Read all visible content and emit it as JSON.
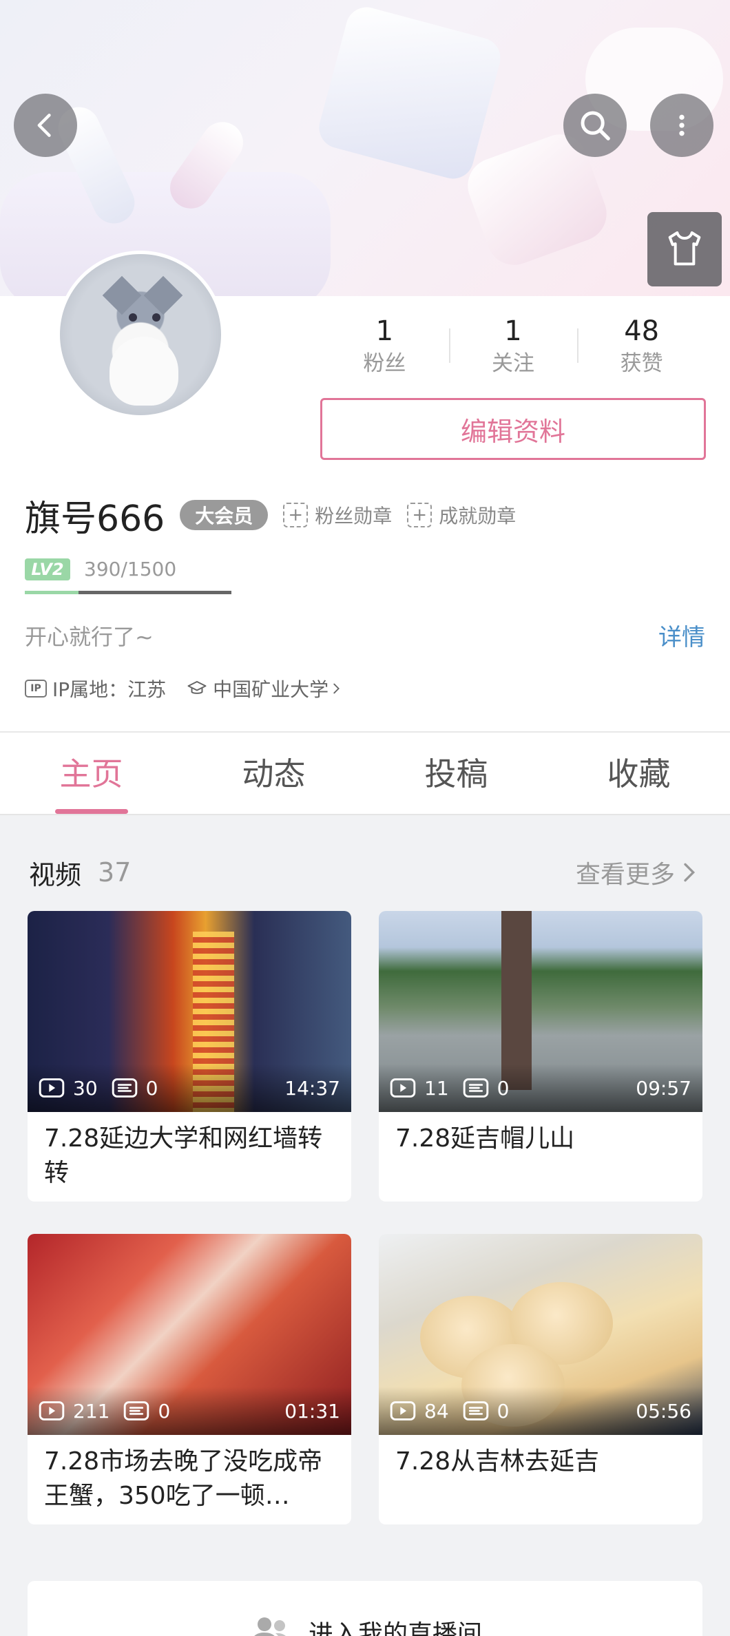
{
  "profile": {
    "username": "旗号666",
    "vip_badge": "大会员",
    "fan_medal": "粉丝勋章",
    "achievement_medal": "成就勋章",
    "level": "LV2",
    "exp_text": "390/1500",
    "exp_progress": 0.26,
    "signature": "开心就行了~",
    "detail_link": "详情",
    "ip_badge": "IP",
    "ip_location": "IP属地：江苏",
    "school": "中国矿业大学"
  },
  "stats": [
    {
      "num": "1",
      "label": "粉丝"
    },
    {
      "num": "1",
      "label": "关注"
    },
    {
      "num": "48",
      "label": "获赞"
    }
  ],
  "edit_button": "编辑资料",
  "tabs": [
    {
      "label": "主页",
      "active": true
    },
    {
      "label": "动态",
      "active": false
    },
    {
      "label": "投稿",
      "active": false
    },
    {
      "label": "收藏",
      "active": false
    }
  ],
  "videos_section": {
    "title": "视频",
    "count": "37",
    "more": "查看更多"
  },
  "videos": [
    {
      "plays": "30",
      "danmaku": "0",
      "duration": "14:37",
      "title": "7.28延边大学和网红墙转转"
    },
    {
      "plays": "11",
      "danmaku": "0",
      "duration": "09:57",
      "title": "7.28延吉帽儿山"
    },
    {
      "plays": "211",
      "danmaku": "0",
      "duration": "01:31",
      "title": "7.28市场去晚了没吃成帝王蟹，350吃了一顿…"
    },
    {
      "plays": "84",
      "danmaku": "0",
      "duration": "05:56",
      "title": "7.28从吉林去延吉"
    }
  ],
  "live_entry": "进入我的直播间",
  "colors": {
    "accent": "#e17598",
    "link": "#4a8fc9",
    "level_green": "#9ad7a6"
  }
}
